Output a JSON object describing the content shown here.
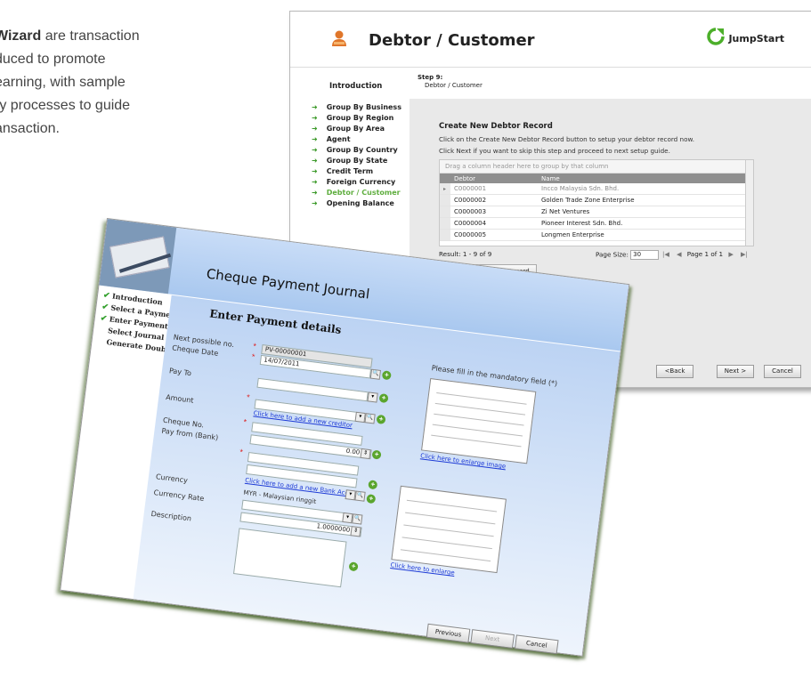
{
  "intro_text": {
    "lines": [
      "Wizard are transaction",
      "duced to promote",
      "earning, with sample",
      "ry processes to guide",
      "ansaction."
    ],
    "bold_word": "Wizard"
  },
  "debtor_window": {
    "title": "Debtor / Customer",
    "brand": "JumpStart",
    "nav_intro": "Introduction",
    "nav_items": [
      "Group By Business",
      "Group By Region",
      "Group By Area",
      "Agent",
      "Group By Country",
      "Group By State",
      "Credit Term",
      "Foreign Currency",
      "Debtor / Customer",
      "Opening Balance"
    ],
    "active_nav": "Debtor / Customer",
    "step_label": "Step 9:",
    "step_name": "Debtor / Customer",
    "section_heading": "Create New Debtor Record",
    "instruction_1": "Click on the Create New Debtor Record button to setup your debtor record now.",
    "instruction_2": "Click Next if you want to skip this step and proceed to next setup guide.",
    "group_hint": "Drag a column header here to group by that column",
    "columns": [
      "Debtor",
      "Name"
    ],
    "rows": [
      [
        "C0000001",
        "Incco Malaysia Sdn. Bhd."
      ],
      [
        "C0000002",
        "Golden Trade Zone Enterprise"
      ],
      [
        "C0000003",
        "Zi Net Ventures"
      ],
      [
        "C0000004",
        "Pioneer Interest Sdn. Bhd."
      ],
      [
        "C0000005",
        "Longmen Enterprise"
      ]
    ],
    "result_text": "Result: 1 - 9 of 9",
    "page_size_label": "Page Size:",
    "page_size_value": "30",
    "page_info": "Page 1 of 1",
    "create_button": "Create New Debtor Record",
    "back_button": "<Back",
    "next_button": "Next >",
    "cancel_button": "Cancel"
  },
  "cheque_window": {
    "title": "Cheque Payment Journal",
    "nav_items": [
      {
        "label": "Introduction",
        "done": true
      },
      {
        "label": "Select a Payment Type",
        "done": true
      },
      {
        "label": "Enter Payment Details",
        "done": true
      },
      {
        "label": "Select Journal",
        "done": false
      },
      {
        "label": "Generate Double Entry",
        "done": false
      }
    ],
    "heading": "Enter Payment details",
    "labels": {
      "next_no": "Next possible no.",
      "cheque_date": "Cheque Date",
      "pay_to": "Pay To",
      "amount": "Amount",
      "cheque_no": "Cheque No.",
      "pay_from": "Pay from (Bank)",
      "currency": "Currency",
      "currency_rate": "Currency Rate",
      "description": "Description"
    },
    "values": {
      "next_no": "PV-00000001",
      "cheque_date": "14/07/2011",
      "amount": "0.00",
      "currency": "MYR - Malaysian ringgit",
      "currency_rate": "1.0000000"
    },
    "links": {
      "new_creditor": "Click here to add a new creditor",
      "new_bank": "Click here to add a new Bank Account",
      "enlarge_image": "Click here to enlarge image",
      "enlarge": "Click here to enlarge"
    },
    "mandatory_note": "Please fill in the mandatory field (*)",
    "buttons": {
      "previous": "Previous",
      "next": "Next",
      "cancel": "Cancel"
    }
  }
}
